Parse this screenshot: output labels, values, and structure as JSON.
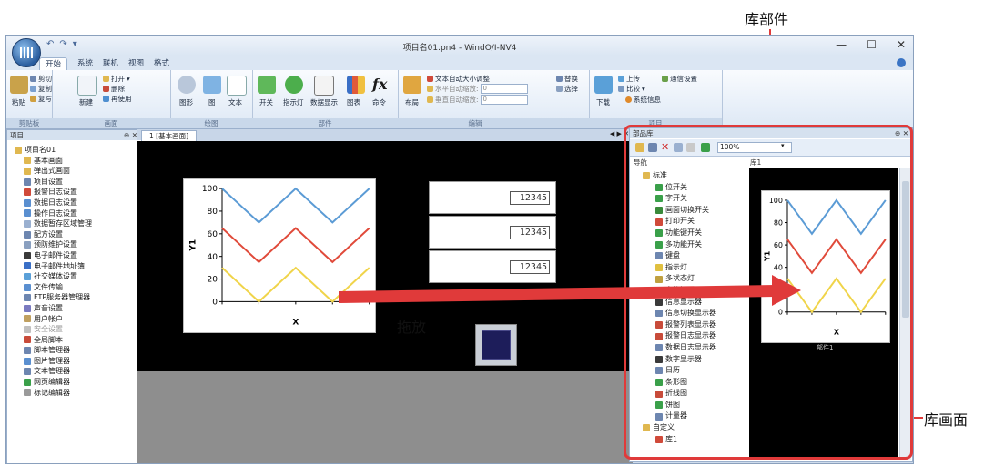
{
  "window": {
    "title": "项目名01.pn4 - WindO/I-NV4",
    "controls": [
      "—",
      "☐",
      "✕"
    ]
  },
  "ribbon": {
    "tabs": [
      "开始",
      "系统",
      "联机",
      "视图",
      "格式"
    ],
    "groups": {
      "clipboard": {
        "label": "剪贴板",
        "paste": "粘贴",
        "cut": "剪切",
        "copy": "复制",
        "format": "复写"
      },
      "screen": {
        "label": "画面",
        "new": "新建",
        "open": "打开",
        "delete": "删除",
        "reuse": "再使用"
      },
      "shapes": {
        "label": "绘图",
        "shape": "图形",
        "image": "图",
        "text": "文本"
      },
      "parts": {
        "label": "部件",
        "switch": "开关",
        "lamp": "指示灯",
        "numeric": "数据显示",
        "chart": "图表",
        "command": "命令"
      },
      "edit": {
        "label": "编辑",
        "layout": "布局",
        "autosize": "文本自动大小调整",
        "pos_h": "水平自动缩放:",
        "pos_v": "垂直自动缩放:",
        "val_h": "0",
        "val_v": "0",
        "replace": "替换",
        "select": "选择"
      },
      "project": {
        "label": "项目",
        "download": "下载",
        "upload": "上传",
        "compare": "比较",
        "comm": "通信设置",
        "sysinfo": "系统信息"
      }
    }
  },
  "project_pane": {
    "title": "项目",
    "pin": "⊕ ✕",
    "items": [
      "项目名01",
      "基本画面",
      "弹出式画面",
      "项目设置",
      "报警日志设置",
      "数据日志设置",
      "操作日志设置",
      "数据暂存区域管理",
      "配方设置",
      "预防维护设置",
      "电子邮件设置",
      "电子邮件地址簿",
      "社交媒体设置",
      "文件传输",
      "FTP服务器管理器",
      "声音设置",
      "用户帐户",
      "安全设置",
      "全局脚本",
      "脚本管理器",
      "图片管理器",
      "文本管理器",
      "网页编辑器",
      "标记编辑器"
    ]
  },
  "editor": {
    "tab_label": "1  [基本画面]",
    "nav": "◀ ▶ ✕",
    "numeric_values": [
      "12345",
      "12345",
      "12345"
    ]
  },
  "chart_data": {
    "type": "line",
    "ylabel": "Y1",
    "xlabel": "X",
    "yticks": [
      "100",
      "80",
      "60",
      "40",
      "20",
      "0"
    ],
    "ylim": [
      0,
      100
    ],
    "x": [
      0,
      1,
      2,
      3,
      4
    ],
    "series": [
      {
        "color": "#5b9bd5",
        "values": [
          100,
          70,
          100,
          70,
          100
        ]
      },
      {
        "color": "#e04a3a",
        "values": [
          65,
          35,
          65,
          35,
          65
        ]
      },
      {
        "color": "#f0d44a",
        "values": [
          30,
          0,
          30,
          0,
          30
        ]
      }
    ]
  },
  "library_pane": {
    "title": "部品库",
    "pin": "⊕ ✕",
    "zoom": "100%",
    "nav_header": "导航",
    "lib_header": "库1",
    "lib_chart_caption": "部件1",
    "tree": [
      "标准",
      "位开关",
      "字开关",
      "画面切换开关",
      "打印开关",
      "功能键开关",
      "多功能开关",
      "键盘",
      "指示灯",
      "多状态灯",
      "字符输入器",
      "信息显示器",
      "信息切换显示器",
      "报警列表显示器",
      "报警日志显示器",
      "数据日志显示器",
      "数字显示器",
      "日历",
      "条形图",
      "折线图",
      "饼图",
      "计量器",
      "自定义",
      "库1"
    ]
  },
  "annotations": {
    "library_parts": "库部件",
    "library_screen": "库画面",
    "drag_drop": "拖放"
  },
  "colors": {
    "annotation_red": "#e03a3a",
    "ribbon_blue": "#dbe6f3",
    "canvas": "#000000"
  }
}
